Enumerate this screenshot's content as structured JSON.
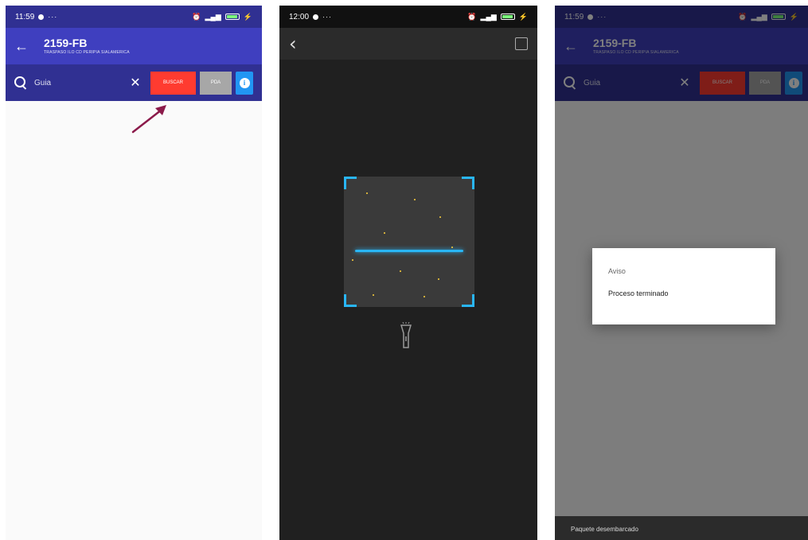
{
  "colors": {
    "header_blue": "#3f3fbf",
    "toolbar_blue": "#303092",
    "buscar_red": "#ff3b30",
    "pda_gray": "#a7a7a7",
    "info_blue": "#2196f3",
    "scanner_accent": "#29b6f6",
    "annotation_arrow": "#8b1a4a"
  },
  "screen1": {
    "status": {
      "time": "11:59"
    },
    "header": {
      "title": "2159-FB",
      "subtitle": "TRASPASO ILO CD PERIPIA SIALAMERICA"
    },
    "search": {
      "placeholder": "Guia",
      "buscar_label": "BUSCAR",
      "pda_label": "PDA",
      "info_label": "i"
    }
  },
  "screen2": {
    "status": {
      "time": "12:00"
    },
    "icons": [
      "chevron-left-icon",
      "gallery-icon",
      "flashlight-icon"
    ]
  },
  "screen3": {
    "status": {
      "time": "11:59"
    },
    "header": {
      "title": "2159-FB",
      "subtitle": "TRASPASO ILO CD PERIPIA SIALAMERICA"
    },
    "search": {
      "placeholder": "Guia",
      "buscar_label": "BUSCAR",
      "pda_label": "PDA",
      "info_label": "i"
    },
    "dialog": {
      "title": "Aviso",
      "message": "Proceso terminado"
    },
    "snackbar": {
      "text": "Paquete desembarcado"
    }
  }
}
